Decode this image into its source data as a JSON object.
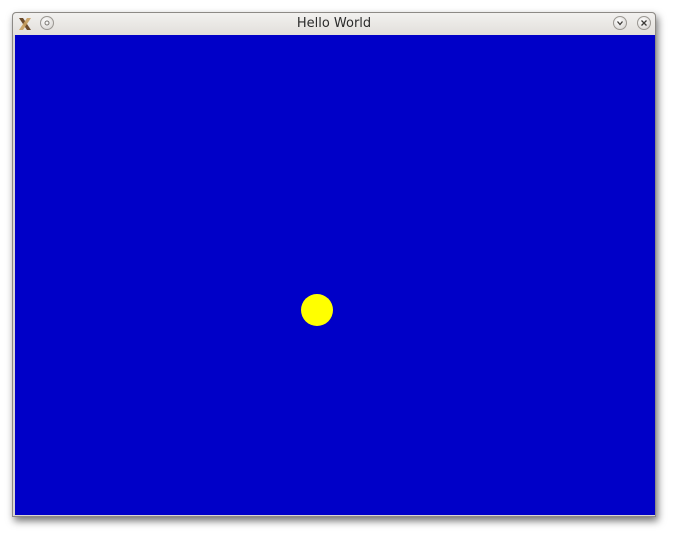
{
  "window": {
    "title": "Hello World",
    "buttons": {
      "menu_icon": "circle-menu-icon",
      "shade_icon": "chevron-down-icon",
      "close_icon": "close-icon"
    }
  },
  "scene": {
    "background_color": "#0000c8",
    "ball": {
      "shape": "circle",
      "color": "#ffff00"
    }
  }
}
